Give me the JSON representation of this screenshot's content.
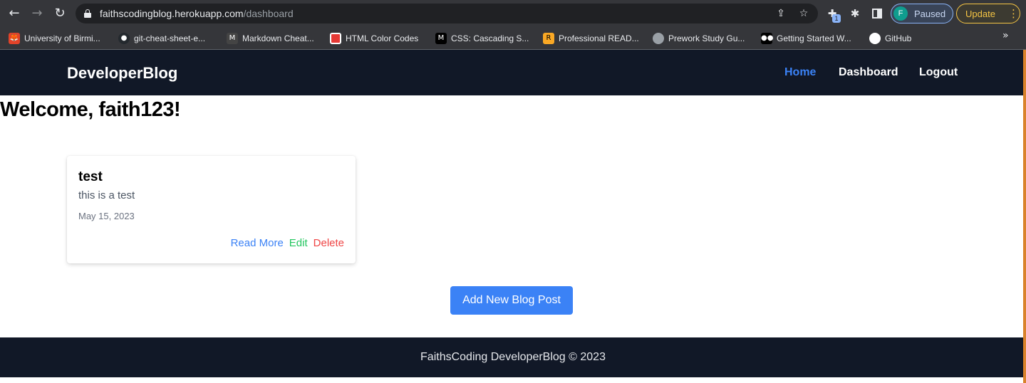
{
  "browser": {
    "url_host": "faithscodingblog.herokuapp.com",
    "url_path": "/dashboard",
    "profile_initial": "F",
    "profile_label": "Paused",
    "update_label": "Update",
    "extension_badge": "1",
    "more_bookmarks": "»",
    "bookmarks": [
      {
        "label": "University of Birmi...",
        "icon": "gitlab-icon",
        "color": "#e24329"
      },
      {
        "label": "git-cheat-sheet-e...",
        "icon": "github-icon",
        "color": "#24292e"
      },
      {
        "label": "Markdown Cheat...",
        "icon": "markdown-icon",
        "color": "#444"
      },
      {
        "label": "HTML Color Codes",
        "icon": "html-color-icon",
        "color": "#e53935"
      },
      {
        "label": "CSS: Cascading S...",
        "icon": "mdn-icon",
        "color": "#000000"
      },
      {
        "label": "Professional READ...",
        "icon": "readme-icon",
        "color": "#f9a825"
      },
      {
        "label": "Prework Study Gu...",
        "icon": "globe-icon",
        "color": "#9aa0a6"
      },
      {
        "label": "Getting Started W...",
        "icon": "medium-icon",
        "color": "#000000"
      },
      {
        "label": "GitHub",
        "icon": "github-icon",
        "color": "#24292e"
      }
    ]
  },
  "header": {
    "brand": "DeveloperBlog",
    "nav": [
      "Home",
      "Dashboard",
      "Logout"
    ],
    "active": "Home"
  },
  "welcome": "Welcome, faith123!",
  "posts": [
    {
      "title": "test",
      "body": "this is a test",
      "date": "May 15, 2023",
      "actions": {
        "read_more": "Read More",
        "edit": "Edit",
        "delete": "Delete"
      }
    }
  ],
  "add_button": "Add New Blog Post",
  "footer": "FaithsCoding DeveloperBlog © 2023",
  "colors": {
    "header_bg": "#111827",
    "accent": "#3b82f6",
    "edit": "#22c55e",
    "delete": "#ef4444"
  }
}
